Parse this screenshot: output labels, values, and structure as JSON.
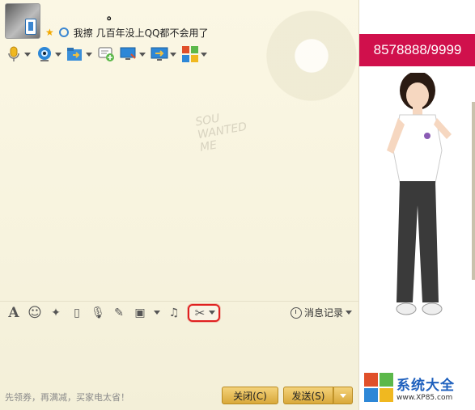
{
  "header": {
    "nickname": "。",
    "signature": "我擦 几百年没上QQ都不会用了",
    "window_controls": [
      "▽",
      "—",
      "☐",
      "✕"
    ]
  },
  "toolbar": {
    "items": [
      {
        "name": "voice-call",
        "icon": "microphone-icon",
        "color": "#f0b820"
      },
      {
        "name": "video-call",
        "icon": "webcam-icon",
        "color": "#2d87d7"
      },
      {
        "name": "send-file",
        "icon": "folder-arrow-icon",
        "color": "#3a8fd9"
      },
      {
        "name": "create-discussion",
        "icon": "chat-add-icon",
        "color": "#5cb84a"
      },
      {
        "name": "remote-desktop",
        "icon": "monitor-icon",
        "color": "#2d87d7"
      },
      {
        "name": "share-screen",
        "icon": "screen-share-icon",
        "color": "#2d87d7"
      },
      {
        "name": "apps",
        "icon": "app-grid-icon",
        "color": "#e0502a"
      }
    ]
  },
  "chat": {
    "decoration_lines": [
      "SOU",
      "WANTED",
      "ME"
    ]
  },
  "input_toolbar": {
    "items": [
      {
        "name": "font",
        "glyph": "A"
      },
      {
        "name": "emoji",
        "glyph": "☺"
      },
      {
        "name": "magic",
        "glyph": "✦"
      },
      {
        "name": "shake",
        "glyph": "▯"
      },
      {
        "name": "voice-message",
        "glyph": "🎙"
      },
      {
        "name": "doodle",
        "glyph": "✎"
      },
      {
        "name": "send-image",
        "glyph": "▣"
      },
      {
        "name": "music",
        "glyph": "♫"
      }
    ],
    "screenshot_glyph": "✂",
    "history_label": "消息记录"
  },
  "bottom": {
    "promo": "先领券，再满减，买家电太省！",
    "close_label": "关闭(C)",
    "send_label": "发送(S)"
  },
  "right_panel": {
    "ad_text": "8578888/9999",
    "ad_color": "#d0104c",
    "site_name": "系统大全",
    "site_url": "www.XP85.com"
  }
}
